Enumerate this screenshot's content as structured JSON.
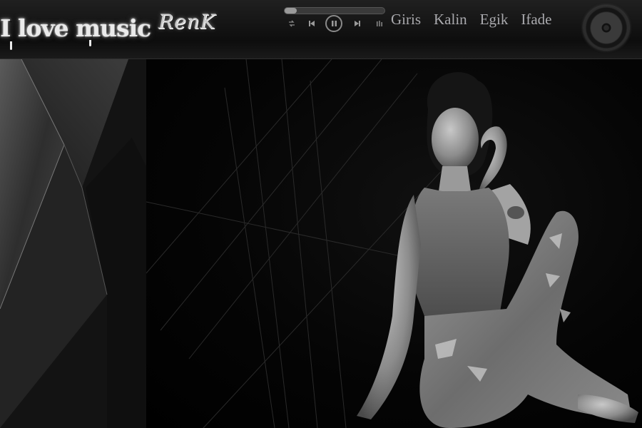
{
  "header": {
    "logo_text": "I love music",
    "brand_text": "RenK"
  },
  "player": {
    "progress_fraction": 0.12,
    "controls": [
      "shuffle-icon",
      "previous-icon",
      "pause-icon",
      "next-icon",
      "equalizer-icon"
    ]
  },
  "nav": {
    "items": [
      {
        "label": "Giris"
      },
      {
        "label": "Kalin"
      },
      {
        "label": "Egik"
      },
      {
        "label": "Ifade"
      }
    ]
  },
  "colors": {
    "background": "#000000",
    "header": "#161616",
    "nav_text": "#a9a9ad",
    "logo_text": "#eaeaea"
  }
}
